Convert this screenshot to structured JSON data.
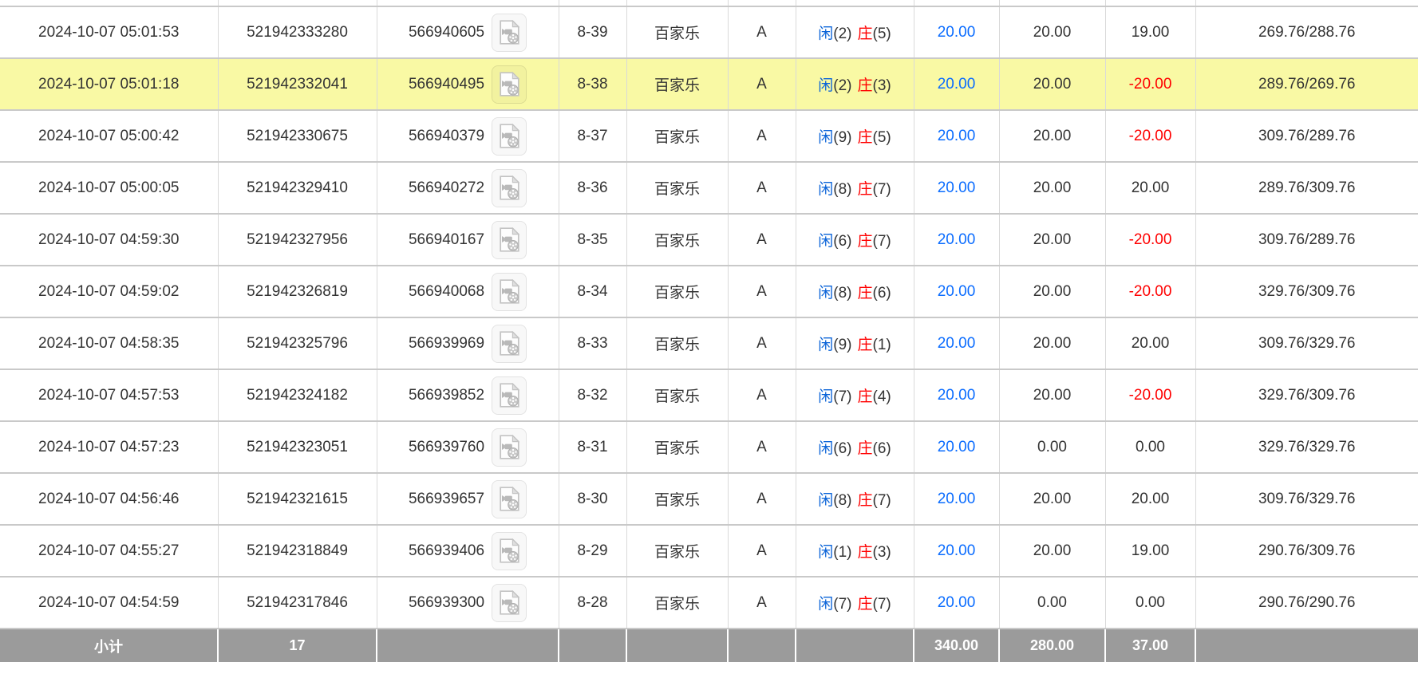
{
  "colors": {
    "highlight_yellow": "#f9f9a4",
    "link_blue": "#0a6cff",
    "player_blue": "#0b64d8",
    "banker_red": "#ff0000",
    "negative_red": "#ff0000",
    "subtotal_gray": "#9b9b9b",
    "border_h": "#c9c9c9",
    "border_v": "#d9d9d9",
    "text_dark": "#333333"
  },
  "icons": {
    "video_replay": "video-replay-icon"
  },
  "table": {
    "rows": [
      {
        "time": "2024-10-07 05:01:53",
        "bet_id": "521942333280",
        "game_id": "566940605",
        "round": "8-39",
        "game_type": "百家乐",
        "table_name": "A",
        "result": {
          "player_label": "闲",
          "player_score": "(2)",
          "banker_label": "庄",
          "banker_score": "(5)"
        },
        "bet_amount": "20.00",
        "valid_bet": "20.00",
        "win_loss": "19.00",
        "balance": "269.76/288.76",
        "highlighted": false
      },
      {
        "time": "2024-10-07 05:01:18",
        "bet_id": "521942332041",
        "game_id": "566940495",
        "round": "8-38",
        "game_type": "百家乐",
        "table_name": "A",
        "result": {
          "player_label": "闲",
          "player_score": "(2)",
          "banker_label": "庄",
          "banker_score": "(3)"
        },
        "bet_amount": "20.00",
        "valid_bet": "20.00",
        "win_loss": "-20.00",
        "balance": "289.76/269.76",
        "highlighted": true
      },
      {
        "time": "2024-10-07 05:00:42",
        "bet_id": "521942330675",
        "game_id": "566940379",
        "round": "8-37",
        "game_type": "百家乐",
        "table_name": "A",
        "result": {
          "player_label": "闲",
          "player_score": "(9)",
          "banker_label": "庄",
          "banker_score": "(5)"
        },
        "bet_amount": "20.00",
        "valid_bet": "20.00",
        "win_loss": "-20.00",
        "balance": "309.76/289.76",
        "highlighted": false
      },
      {
        "time": "2024-10-07 05:00:05",
        "bet_id": "521942329410",
        "game_id": "566940272",
        "round": "8-36",
        "game_type": "百家乐",
        "table_name": "A",
        "result": {
          "player_label": "闲",
          "player_score": "(8)",
          "banker_label": "庄",
          "banker_score": "(7)"
        },
        "bet_amount": "20.00",
        "valid_bet": "20.00",
        "win_loss": "20.00",
        "balance": "289.76/309.76",
        "highlighted": false
      },
      {
        "time": "2024-10-07 04:59:30",
        "bet_id": "521942327956",
        "game_id": "566940167",
        "round": "8-35",
        "game_type": "百家乐",
        "table_name": "A",
        "result": {
          "player_label": "闲",
          "player_score": "(6)",
          "banker_label": "庄",
          "banker_score": "(7)"
        },
        "bet_amount": "20.00",
        "valid_bet": "20.00",
        "win_loss": "-20.00",
        "balance": "309.76/289.76",
        "highlighted": false
      },
      {
        "time": "2024-10-07 04:59:02",
        "bet_id": "521942326819",
        "game_id": "566940068",
        "round": "8-34",
        "game_type": "百家乐",
        "table_name": "A",
        "result": {
          "player_label": "闲",
          "player_score": "(8)",
          "banker_label": "庄",
          "banker_score": "(6)"
        },
        "bet_amount": "20.00",
        "valid_bet": "20.00",
        "win_loss": "-20.00",
        "balance": "329.76/309.76",
        "highlighted": false
      },
      {
        "time": "2024-10-07 04:58:35",
        "bet_id": "521942325796",
        "game_id": "566939969",
        "round": "8-33",
        "game_type": "百家乐",
        "table_name": "A",
        "result": {
          "player_label": "闲",
          "player_score": "(9)",
          "banker_label": "庄",
          "banker_score": "(1)"
        },
        "bet_amount": "20.00",
        "valid_bet": "20.00",
        "win_loss": "20.00",
        "balance": "309.76/329.76",
        "highlighted": false
      },
      {
        "time": "2024-10-07 04:57:53",
        "bet_id": "521942324182",
        "game_id": "566939852",
        "round": "8-32",
        "game_type": "百家乐",
        "table_name": "A",
        "result": {
          "player_label": "闲",
          "player_score": "(7)",
          "banker_label": "庄",
          "banker_score": "(4)"
        },
        "bet_amount": "20.00",
        "valid_bet": "20.00",
        "win_loss": "-20.00",
        "balance": "329.76/309.76",
        "highlighted": false
      },
      {
        "time": "2024-10-07 04:57:23",
        "bet_id": "521942323051",
        "game_id": "566939760",
        "round": "8-31",
        "game_type": "百家乐",
        "table_name": "A",
        "result": {
          "player_label": "闲",
          "player_score": "(6)",
          "banker_label": "庄",
          "banker_score": "(6)"
        },
        "bet_amount": "20.00",
        "valid_bet": "0.00",
        "win_loss": "0.00",
        "balance": "329.76/329.76",
        "highlighted": false
      },
      {
        "time": "2024-10-07 04:56:46",
        "bet_id": "521942321615",
        "game_id": "566939657",
        "round": "8-30",
        "game_type": "百家乐",
        "table_name": "A",
        "result": {
          "player_label": "闲",
          "player_score": "(8)",
          "banker_label": "庄",
          "banker_score": "(7)"
        },
        "bet_amount": "20.00",
        "valid_bet": "20.00",
        "win_loss": "20.00",
        "balance": "309.76/329.76",
        "highlighted": false
      },
      {
        "time": "2024-10-07 04:55:27",
        "bet_id": "521942318849",
        "game_id": "566939406",
        "round": "8-29",
        "game_type": "百家乐",
        "table_name": "A",
        "result": {
          "player_label": "闲",
          "player_score": "(1)",
          "banker_label": "庄",
          "banker_score": "(3)"
        },
        "bet_amount": "20.00",
        "valid_bet": "20.00",
        "win_loss": "19.00",
        "balance": "290.76/309.76",
        "highlighted": false
      },
      {
        "time": "2024-10-07 04:54:59",
        "bet_id": "521942317846",
        "game_id": "566939300",
        "round": "8-28",
        "game_type": "百家乐",
        "table_name": "A",
        "result": {
          "player_label": "闲",
          "player_score": "(7)",
          "banker_label": "庄",
          "banker_score": "(7)"
        },
        "bet_amount": "20.00",
        "valid_bet": "0.00",
        "win_loss": "0.00",
        "balance": "290.76/290.76",
        "highlighted": false
      }
    ],
    "subtotal": {
      "label": "小计",
      "count": "17",
      "bet_amount_total": "340.00",
      "valid_bet_total": "280.00",
      "win_loss_total": "37.00"
    }
  }
}
